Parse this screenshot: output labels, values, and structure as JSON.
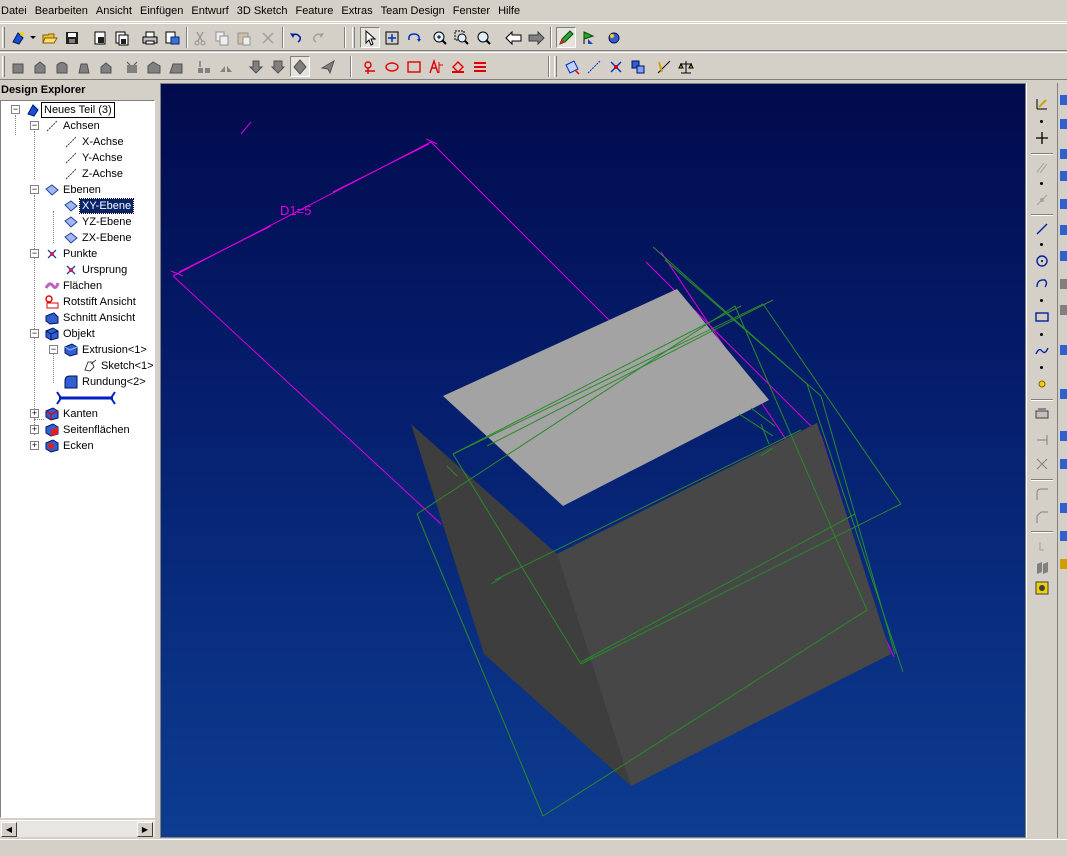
{
  "menu": [
    "Datei",
    "Bearbeiten",
    "Ansicht",
    "Einfügen",
    "Entwurf",
    "3D Sketch",
    "Feature",
    "Extras",
    "Team Design",
    "Fenster",
    "Hilfe"
  ],
  "explorer": {
    "title": "Design Explorer",
    "tree": {
      "root": "Neues Teil (3)",
      "achsen": "Achsen",
      "x_achse": "X-Achse",
      "y_achse": "Y-Achse",
      "z_achse": "Z-Achse",
      "ebenen": "Ebenen",
      "xy_ebene": "XY-Ebene",
      "yz_ebene": "YZ-Ebene",
      "zx_ebene": "ZX-Ebene",
      "punkte": "Punkte",
      "ursprung": "Ursprung",
      "flaechen": "Flächen",
      "rotstift": "Rotstift Ansicht",
      "schnitt": "Schnitt Ansicht",
      "objekt": "Objekt",
      "extrusion": "Extrusion<1>",
      "sketch": "Sketch<1>",
      "rundung": "Rundung<2>",
      "kanten": "Kanten",
      "seitenflaechen": "Seitenflächen",
      "ecken": "Ecken"
    }
  },
  "viewport": {
    "dimension_label": "D1=5"
  },
  "colors": {
    "sketch_magenta": "#e000e0",
    "constraint_green": "#2a8a2a",
    "selection": "#0a246a"
  }
}
